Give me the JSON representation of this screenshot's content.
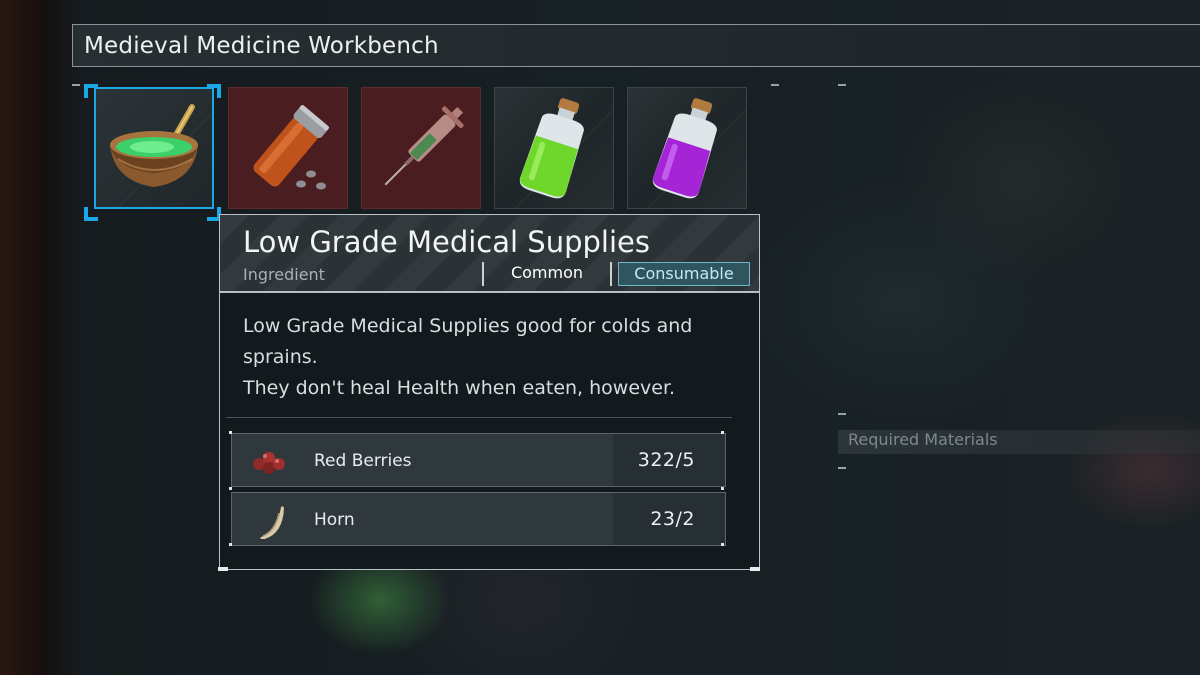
{
  "workbench": {
    "title": "Medieval Medicine Workbench"
  },
  "recipes": [
    {
      "name": "Low Grade Medical Supplies",
      "icon": "mortar-bowl-icon",
      "selected": true
    },
    {
      "name": "",
      "icon": "pill-bottle-icon",
      "selected": false
    },
    {
      "name": "",
      "icon": "syringe-icon",
      "selected": false
    },
    {
      "name": "",
      "icon": "green-potion-icon",
      "selected": false
    },
    {
      "name": "",
      "icon": "purple-potion-icon",
      "selected": false
    }
  ],
  "tooltip": {
    "name": "Low Grade Medical Supplies",
    "type": "Ingredient",
    "rarity": "Common",
    "category": "Consumable",
    "description_line1": "Low Grade Medical Supplies good for colds and",
    "description_line2": "sprains.",
    "description_line3": "They don't heal Health when eaten, however.",
    "materials": [
      {
        "name": "Red Berries",
        "quantity": "322/5",
        "icon": "red-berries-icon"
      },
      {
        "name": "Horn",
        "quantity": "23/2",
        "icon": "horn-icon"
      }
    ]
  },
  "required_materials": {
    "label": "Required Materials"
  },
  "colors": {
    "selection": "#1ba8e8",
    "consumable_bg": "#30555e",
    "red_slot": "#4a1d20"
  }
}
